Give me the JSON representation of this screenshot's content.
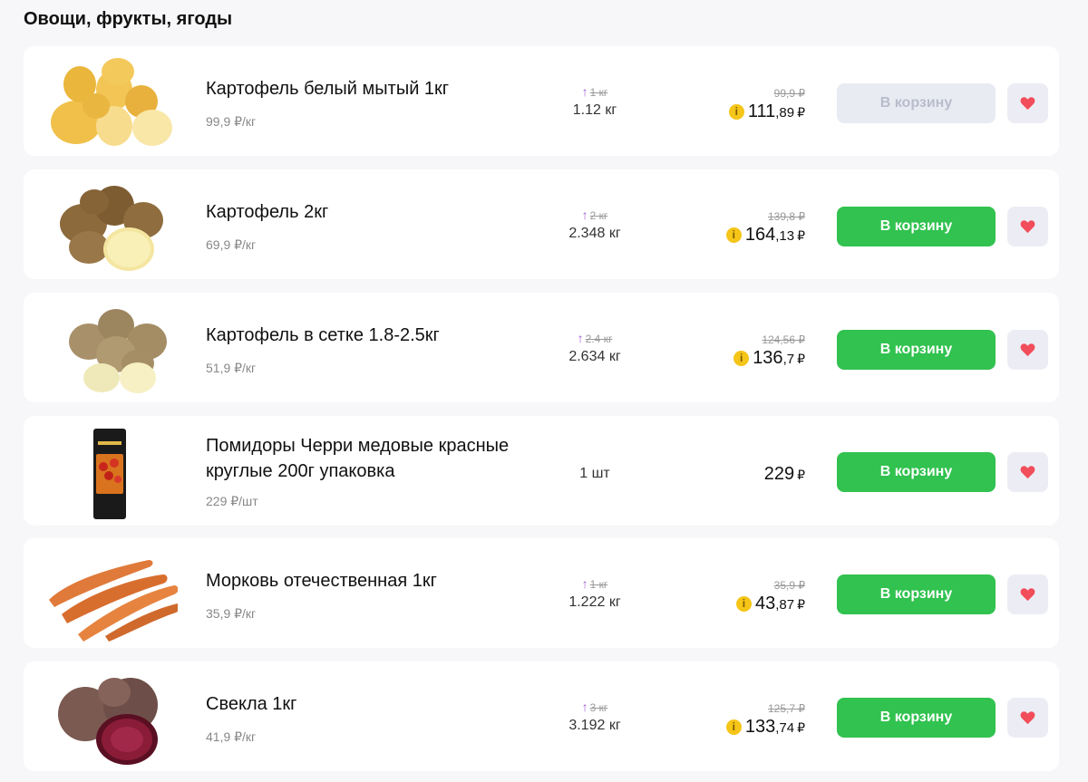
{
  "section": {
    "title": "Овощи, фрукты, ягоды"
  },
  "colors": {
    "accent_green": "#31c24f",
    "disabled_button": "#e9ebf3",
    "favorite_heart": "#f24d5b",
    "coin": "#f5c518",
    "qty_arrow": "#a25fd1"
  },
  "products": [
    {
      "name": "Картофель белый мытый 1кг",
      "unit_price": "99,9 ₽/кг",
      "qty_old": "1 кг",
      "qty_new": "1.12 кг",
      "price_old": "99,9 ₽",
      "price_main": "111",
      "price_kop": ",89",
      "currency": "₽",
      "coin_icon": "i",
      "button": "В корзину",
      "button_disabled": true,
      "image_icon": "white-potatoes"
    },
    {
      "name": "Картофель 2кг",
      "unit_price": "69,9 ₽/кг",
      "qty_old": "2 кг",
      "qty_new": "2.348 кг",
      "price_old": "139,8 ₽",
      "price_main": "164",
      "price_kop": ",13",
      "currency": "₽",
      "coin_icon": "i",
      "button": "В корзину",
      "button_disabled": false,
      "image_icon": "brown-potatoes"
    },
    {
      "name": "Картофель в сетке 1.8-2.5кг",
      "unit_price": "51,9 ₽/кг",
      "qty_old": "2.4 кг",
      "qty_new": "2.634 кг",
      "price_old": "124,56 ₽",
      "price_main": "136",
      "price_kop": ",7",
      "currency": "₽",
      "coin_icon": "i",
      "button": "В корзину",
      "button_disabled": false,
      "image_icon": "potatoes"
    },
    {
      "name": "Помидоры Черри медовые красные круглые 200г упаковка",
      "unit_price": "229 ₽/шт",
      "qty_old": "",
      "qty_new": "1 шт",
      "price_old": "",
      "price_main": "229",
      "price_kop": "",
      "currency": "₽",
      "coin_icon": "",
      "button": "В корзину",
      "button_disabled": false,
      "image_icon": "cherry-tomato-pack"
    },
    {
      "name": "Морковь отечественная 1кг",
      "unit_price": "35,9 ₽/кг",
      "qty_old": "1 кг",
      "qty_new": "1.222 кг",
      "price_old": "35,9 ₽",
      "price_main": "43",
      "price_kop": ",87",
      "currency": "₽",
      "coin_icon": "i",
      "button": "В корзину",
      "button_disabled": false,
      "image_icon": "carrots"
    },
    {
      "name": "Свекла 1кг",
      "unit_price": "41,9 ₽/кг",
      "qty_old": "3 кг",
      "qty_new": "3.192 кг",
      "price_old": "125,7 ₽",
      "price_main": "133",
      "price_kop": ",74",
      "currency": "₽",
      "coin_icon": "i",
      "button": "В корзину",
      "button_disabled": false,
      "image_icon": "beetroot"
    }
  ]
}
